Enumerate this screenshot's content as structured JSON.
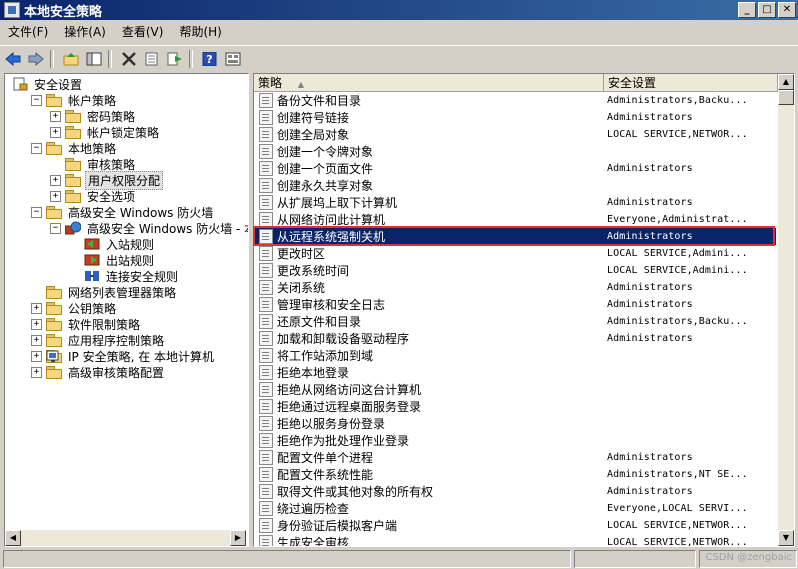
{
  "window": {
    "title": "本地安全策略"
  },
  "window_buttons": [
    "_",
    "□",
    "✕"
  ],
  "menu": [
    "文件(F)",
    "操作(A)",
    "查看(V)",
    "帮助(H)"
  ],
  "toolbar_icons": [
    "back-icon",
    "forward-icon",
    "up-folder-icon",
    "show-tree-icon",
    "delete-icon",
    "properties-icon",
    "export-icon",
    "help-icon",
    "view-icon"
  ],
  "tree": [
    {
      "label": "安全设置",
      "level": 0,
      "exp": "",
      "icon": "root"
    },
    {
      "label": "帐户策略",
      "level": 1,
      "exp": "−",
      "icon": "folder"
    },
    {
      "label": "密码策略",
      "level": 2,
      "exp": "+",
      "icon": "folder"
    },
    {
      "label": "帐户锁定策略",
      "level": 2,
      "exp": "+",
      "icon": "folder"
    },
    {
      "label": "本地策略",
      "level": 1,
      "exp": "−",
      "icon": "folder"
    },
    {
      "label": "审核策略",
      "level": 2,
      "exp": "",
      "icon": "folder"
    },
    {
      "label": "用户权限分配",
      "level": 2,
      "exp": "+",
      "icon": "folder",
      "selected": true
    },
    {
      "label": "安全选项",
      "level": 2,
      "exp": "+",
      "icon": "folder"
    },
    {
      "label": "高级安全 Windows 防火墙",
      "level": 1,
      "exp": "−",
      "icon": "folder"
    },
    {
      "label": "高级安全 Windows 防火墙 - 本地",
      "level": 2,
      "exp": "−",
      "icon": "firewall"
    },
    {
      "label": "入站规则",
      "level": 3,
      "exp": "",
      "icon": "rule-in"
    },
    {
      "label": "出站规则",
      "level": 3,
      "exp": "",
      "icon": "rule-out"
    },
    {
      "label": "连接安全规则",
      "level": 3,
      "exp": "",
      "icon": "rule-conn"
    },
    {
      "label": "网络列表管理器策略",
      "level": 1,
      "exp": "",
      "icon": "folder"
    },
    {
      "label": "公钥策略",
      "level": 1,
      "exp": "+",
      "icon": "folder"
    },
    {
      "label": "软件限制策略",
      "level": 1,
      "exp": "+",
      "icon": "folder"
    },
    {
      "label": "应用程序控制策略",
      "level": 1,
      "exp": "+",
      "icon": "folder"
    },
    {
      "label": "IP 安全策略, 在 本地计算机",
      "level": 1,
      "exp": "+",
      "icon": "ipsec"
    },
    {
      "label": "高级审核策略配置",
      "level": 1,
      "exp": "+",
      "icon": "folder"
    }
  ],
  "columns": {
    "policy": "策略",
    "security": "安全设置"
  },
  "policies": [
    {
      "name": "备份文件和目录",
      "value": "Administrators,Backu..."
    },
    {
      "name": "创建符号链接",
      "value": "Administrators"
    },
    {
      "name": "创建全局对象",
      "value": "LOCAL SERVICE,NETWOR..."
    },
    {
      "name": "创建一个令牌对象",
      "value": ""
    },
    {
      "name": "创建一个页面文件",
      "value": "Administrators"
    },
    {
      "name": "创建永久共享对象",
      "value": ""
    },
    {
      "name": "从扩展坞上取下计算机",
      "value": "Administrators"
    },
    {
      "name": "从网络访问此计算机",
      "value": "Everyone,Administrat..."
    },
    {
      "name": "从远程系统强制关机",
      "value": "Administrators",
      "selected": true
    },
    {
      "name": "更改时区",
      "value": "LOCAL SERVICE,Admini..."
    },
    {
      "name": "更改系统时间",
      "value": "LOCAL SERVICE,Admini..."
    },
    {
      "name": "关闭系统",
      "value": "Administrators"
    },
    {
      "name": "管理审核和安全日志",
      "value": "Administrators"
    },
    {
      "name": "还原文件和目录",
      "value": "Administrators,Backu..."
    },
    {
      "name": "加载和卸载设备驱动程序",
      "value": "Administrators"
    },
    {
      "name": "将工作站添加到域",
      "value": ""
    },
    {
      "name": "拒绝本地登录",
      "value": ""
    },
    {
      "name": "拒绝从网络访问这台计算机",
      "value": ""
    },
    {
      "name": "拒绝通过远程桌面服务登录",
      "value": ""
    },
    {
      "name": "拒绝以服务身份登录",
      "value": ""
    },
    {
      "name": "拒绝作为批处理作业登录",
      "value": ""
    },
    {
      "name": "配置文件单个进程",
      "value": "Administrators"
    },
    {
      "name": "配置文件系统性能",
      "value": "Administrators,NT SE..."
    },
    {
      "name": "取得文件或其他对象的所有权",
      "value": "Administrators"
    },
    {
      "name": "绕过遍历检查",
      "value": "Everyone,LOCAL SERVI..."
    },
    {
      "name": "身份验证后模拟客户端",
      "value": "LOCAL SERVICE,NETWOR..."
    },
    {
      "name": "生成安全审核",
      "value": "LOCAL SERVICE,NETWOR..."
    }
  ],
  "watermark": "CSDN @zengbaic",
  "colors": {
    "selection": "#0a246a",
    "highlight_box": "#e03030",
    "titlebar": "#0a246a"
  }
}
